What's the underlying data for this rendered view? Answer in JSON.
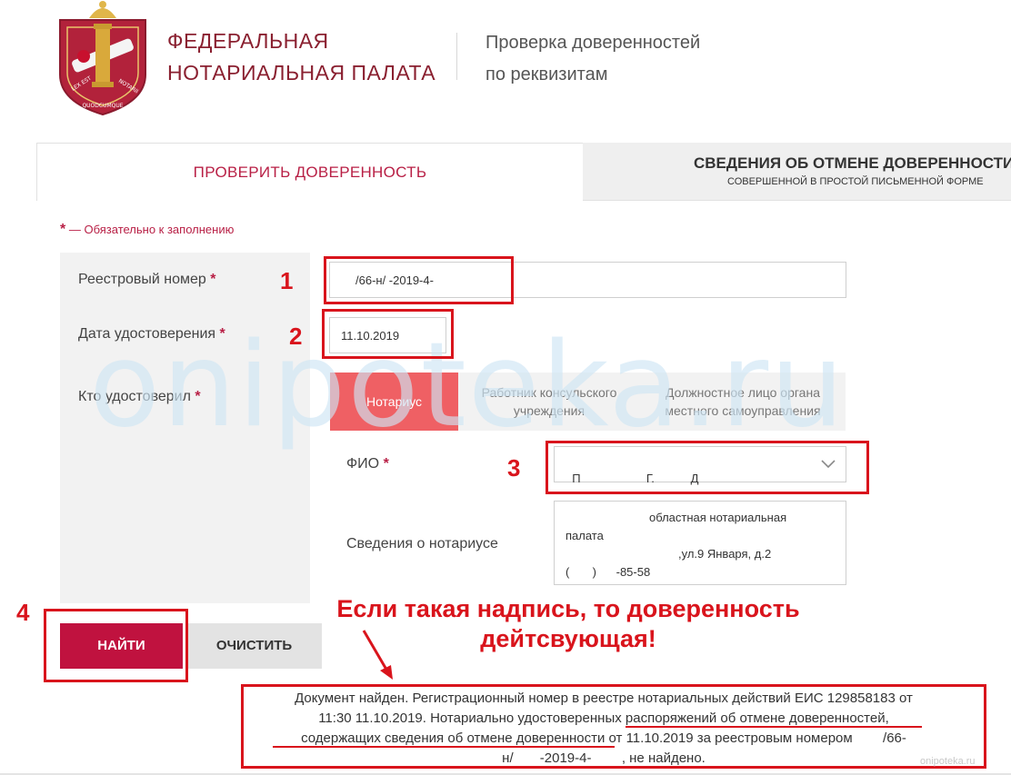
{
  "header": {
    "org_line1": "ФЕДЕРАЛЬНАЯ",
    "org_line2": "НОТАРИАЛЬНАЯ ПАЛАТА",
    "subtitle_line1": "Проверка доверенностей",
    "subtitle_line2": "по реквизитам",
    "logo_text_left": "LEX EST",
    "logo_text_right": "NOTARII",
    "logo_text_bottom": "QUODCUMQUE"
  },
  "tabs": {
    "check_label": "ПРОВЕРИТЬ ДОВЕРЕННОСТЬ",
    "cancel_title": "СВЕДЕНИЯ ОБ ОТМЕНЕ ДОВЕРЕННОСТИ",
    "cancel_subtitle": "СОВЕРШЕННОЙ В ПРОСТОЙ ПИСЬМЕННОЙ ФОРМЕ"
  },
  "form": {
    "required_star": "*",
    "required_note": "— Обязательно к заполнению",
    "registry_label": "Реестровый номер",
    "registry_value": "/66-н/     -2019-4-",
    "date_label": "Дата удостоверения",
    "date_value": "11.10.2019",
    "who_label": "Кто удостоверил",
    "who_options": [
      "Нотариус",
      "Работник консульского учреждения",
      "Должностное лицо органа местного самоуправления"
    ],
    "fio_label": "ФИО",
    "fio_value": "П                    Г.           Д",
    "notary_label": "Сведения о нотариусе",
    "notary_line1": "областная нотариальная",
    "notary_line2": "палата",
    "notary_line3": ",ул.9 Января, д.2",
    "notary_line4": "(       )      -85-58"
  },
  "buttons": {
    "find": "НАЙТИ",
    "clear": "ОЧИСТИТЬ"
  },
  "annotations": {
    "n1": "1",
    "n2": "2",
    "n3": "3",
    "n4": "4",
    "callout_line1": "Если такая надпись, то доверенность",
    "callout_line2": "дейтсвующая!",
    "color": "#d9141c"
  },
  "result": {
    "line1": "Документ найден. Регистрационный номер в реестре нотариальных действий ЕИС 129858183 от",
    "line2": "11:30 11.10.2019. Нотариально удостоверенных распоряжений об отмене доверенностей,",
    "line3": "содержащих сведения об отмене доверенности от 11.10.2019 за реестровым номером        /66-",
    "line4": "н/       -2019-4-        , не найдено."
  },
  "watermark": "onipoteka.ru",
  "corner_mark": "onipoteka.ru",
  "colors": {
    "brand": "#b81f45",
    "find_button": "#c0123f",
    "notary_option": "#ef6064"
  }
}
